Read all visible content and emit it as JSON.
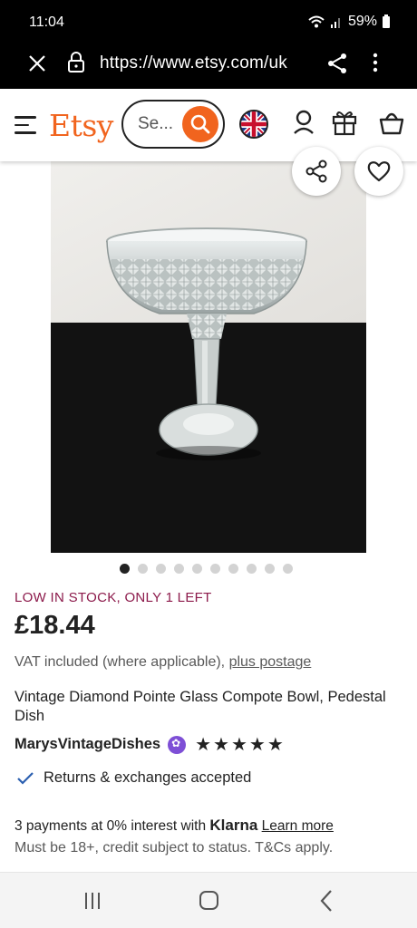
{
  "status": {
    "time": "11:04",
    "battery": "59%"
  },
  "browser": {
    "url": "https://www.etsy.com/uk"
  },
  "header": {
    "logo": "Etsy",
    "search_placeholder": "Se..."
  },
  "carousel": {
    "total": 10,
    "active_index": 0
  },
  "product": {
    "stock_notice": "LOW IN STOCK, ONLY 1 LEFT",
    "price": "£18.44",
    "vat_text": "VAT included (where applicable), ",
    "postage_link": "plus postage",
    "title": "Vintage Diamond Pointe Glass Compote Bowl, Pedestal Dish",
    "shop_name": "MarysVintageDishes",
    "rating_stars": "★★★★★",
    "rating": 5,
    "returns": "Returns & exchanges accepted",
    "klarna_prefix": "3 payments at 0% interest with ",
    "klarna_brand": "Klarna",
    "klarna_link": "Learn more",
    "klarna_note": "Must be 18+, credit subject to status. T&Cs apply."
  },
  "colors": {
    "brand": "#f1641e",
    "stock": "#8c1a4b",
    "star_seller": "#7e4fd6",
    "check": "#2b5fb0"
  }
}
